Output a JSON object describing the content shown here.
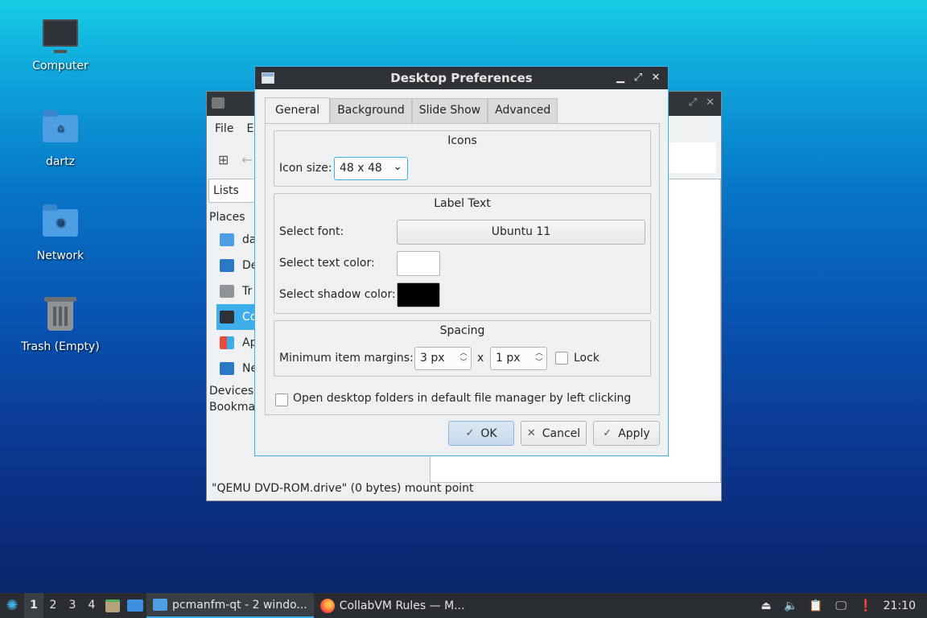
{
  "desktop": {
    "icons": [
      {
        "label": "Computer"
      },
      {
        "label": "dartz"
      },
      {
        "label": "Network"
      },
      {
        "label": "Trash (Empty)"
      }
    ]
  },
  "file_manager": {
    "menu": [
      "File",
      "E"
    ],
    "side_combo": "Lists",
    "places_header": "Places",
    "places": [
      "da",
      "De",
      "Tr",
      "Co",
      "Ap",
      "Ne"
    ],
    "devices_header": "Devices",
    "bookmarks_header": "Bookma",
    "status": "\"QEMU DVD-ROM.drive\" (0 bytes) mount point"
  },
  "dialog": {
    "title": "Desktop Preferences",
    "tabs": [
      "General",
      "Background",
      "Slide Show",
      "Advanced"
    ],
    "icons_group": {
      "title": "Icons",
      "icon_size_label": "Icon size:",
      "icon_size_value": "48 x 48"
    },
    "label_group": {
      "title": "Label Text",
      "font_label": "Select font:",
      "font_value": "Ubuntu 11",
      "text_color_label": "Select text color:",
      "text_color": "#ffffff",
      "shadow_color_label": "Select shadow color:",
      "shadow_color": "#000000"
    },
    "spacing_group": {
      "title": "Spacing",
      "margins_label": "Minimum item margins:",
      "margin_x": "3 px",
      "times": "x",
      "margin_y": "1 px",
      "lock_label": "Lock"
    },
    "open_folders_label": "Open desktop folders in default file manager by left clicking",
    "buttons": {
      "ok": "OK",
      "cancel": "Cancel",
      "apply": "Apply"
    }
  },
  "taskbar": {
    "desktops": [
      "1",
      "2",
      "3",
      "4"
    ],
    "tasks": [
      "pcmanfm-qt - 2 windo...",
      "CollabVM Rules — M..."
    ],
    "clock": "21:10"
  },
  "colors": {
    "accent": "#3daee9",
    "titlebar": "#2f3338"
  }
}
